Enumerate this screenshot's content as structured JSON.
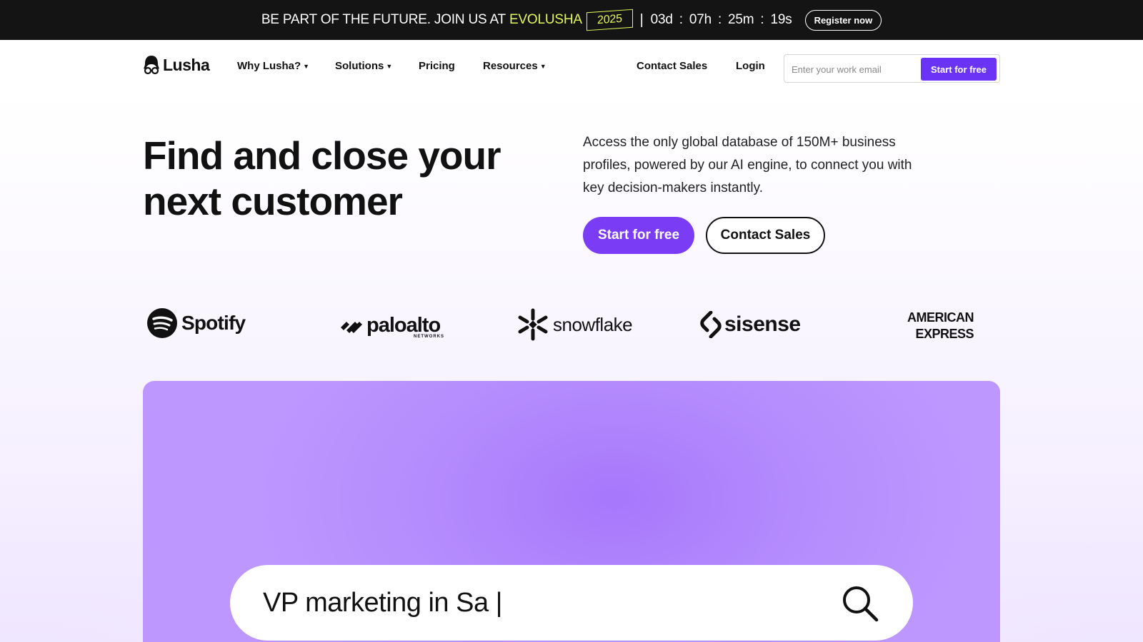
{
  "announcement": {
    "text": "BE PART OF THE FUTURE. JOIN US AT",
    "highlight": "EVOLUSHA",
    "year": "2025",
    "separator": "|",
    "countdown": {
      "days": "03d",
      "hours": "07h",
      "minutes": "25m",
      "seconds": "19s",
      "colon": ":"
    },
    "register_label": "Register now"
  },
  "nav": {
    "logo_text": "Lusha",
    "links": [
      {
        "label": "Why Lusha?",
        "dropdown": true
      },
      {
        "label": "Solutions",
        "dropdown": true
      },
      {
        "label": "Pricing",
        "dropdown": false
      },
      {
        "label": "Resources",
        "dropdown": true
      }
    ],
    "contact_sales": "Contact Sales",
    "login": "Login",
    "email_placeholder": "Enter your work email",
    "email_button": "Start for free"
  },
  "hero": {
    "headline": "Find and close your next customer",
    "subcopy": "Access the only global database of 150M+ business profiles, powered by our AI engine, to connect you with key decision-makers instantly.",
    "primary_cta": "Start for free",
    "secondary_cta": "Contact Sales"
  },
  "logos": {
    "spotify": "Spotify",
    "paloalto": "paloalto",
    "paloalto_sub": "NETWORKS",
    "snowflake": "snowflake",
    "sisense": "sisense",
    "amex_line1": "AMERICAN",
    "amex_line2": "EXPRESS"
  },
  "demo": {
    "search_value": "VP marketing in Sa |"
  },
  "colors": {
    "accent": "#7a3cf5",
    "announce_bg": "#141414",
    "highlight": "#e4f75a",
    "panel": "#b58cfd"
  }
}
